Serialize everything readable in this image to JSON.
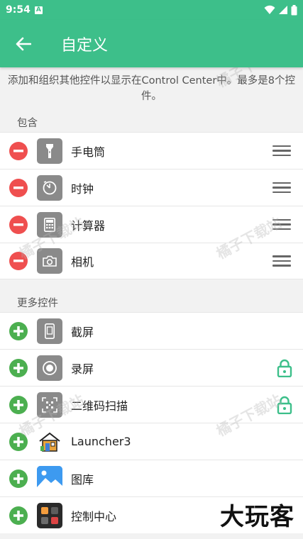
{
  "status": {
    "time": "9:54",
    "notif_badge": "A"
  },
  "toolbar": {
    "title": "自定义"
  },
  "description": "添加和组织其他控件以显示在Control Center中。最多是8个控件。",
  "included": {
    "label": "包含",
    "items": [
      {
        "label": "手电筒",
        "icon": "flashlight-icon"
      },
      {
        "label": "时钟",
        "icon": "timer-icon"
      },
      {
        "label": "计算器",
        "icon": "calculator-icon"
      },
      {
        "label": "相机",
        "icon": "camera-icon"
      }
    ]
  },
  "more": {
    "label": "更多控件",
    "items": [
      {
        "label": "截屏",
        "icon": "screenshot-icon",
        "locked": false
      },
      {
        "label": "录屏",
        "icon": "screen-record-icon",
        "locked": true
      },
      {
        "label": "二维码扫描",
        "icon": "qr-scan-icon",
        "locked": true
      },
      {
        "label": "Launcher3",
        "icon": "launcher-home-icon",
        "locked": false
      },
      {
        "label": "图库",
        "icon": "gallery-icon",
        "locked": false
      },
      {
        "label": "控制中心",
        "icon": "control-center-icon",
        "locked": false
      }
    ]
  },
  "watermark_text": "橘子下载站",
  "brand_text": "大玩客",
  "colors": {
    "accent": "#3dbf8a",
    "remove": "#ef4f4f",
    "add": "#4caf50"
  }
}
